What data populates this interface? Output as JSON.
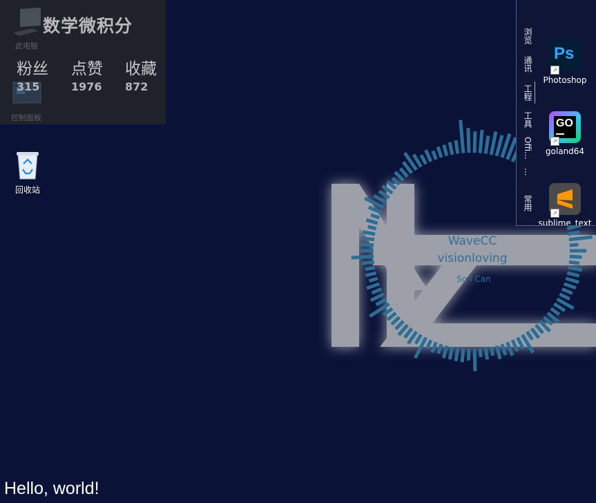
{
  "desktop": {
    "background_color": "#0b1238",
    "icons": [
      {
        "name": "此电脑",
        "icon": "computer-icon"
      },
      {
        "name": "控制面板",
        "icon": "control-panel-icon"
      },
      {
        "name": "回收站",
        "icon": "recycle-bin-icon"
      }
    ]
  },
  "stats": {
    "title": "数学微积分",
    "followers_label": "粉丝",
    "likes_label": "点赞",
    "favorites_label": "收藏",
    "followers": "315",
    "likes": "1976",
    "favorites": "872"
  },
  "visualizer": {
    "line1": "WaveCC",
    "line2": "visionloving",
    "line3": "So  I Can",
    "accent_color": "#2c6e95",
    "logo_color": "#9da0a8"
  },
  "dock": {
    "tabs": [
      "浏览",
      "通讯",
      "工程",
      "工具",
      "Offi...",
      "...",
      "常用"
    ],
    "selected_tab": "工程",
    "apps": [
      {
        "label": "Photoshop",
        "icon": "photoshop-icon"
      },
      {
        "label": "goland64",
        "icon": "goland-icon"
      },
      {
        "label": "sublime_text",
        "icon": "sublime-text-icon"
      }
    ]
  },
  "overlay_text": "Hello, world!"
}
